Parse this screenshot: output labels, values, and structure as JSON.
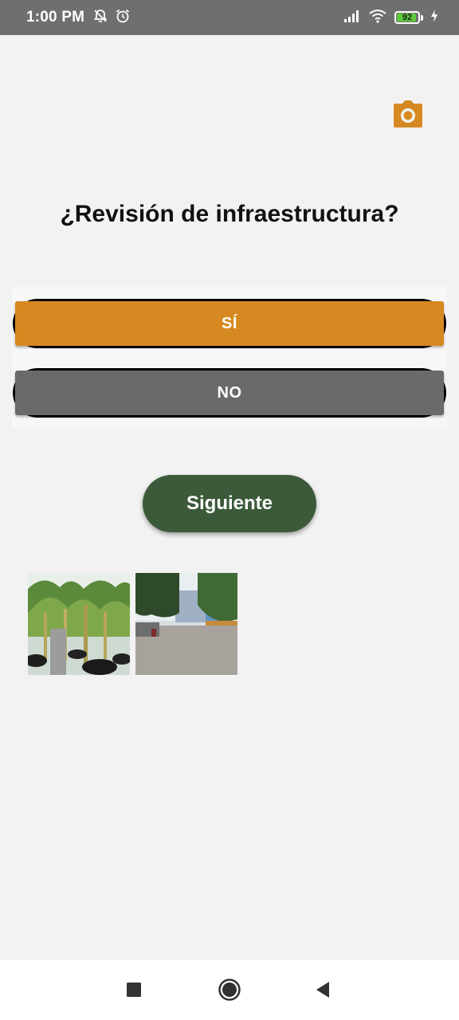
{
  "status_bar": {
    "time": "1:00 PM",
    "battery_level": "92",
    "battery_fraction": 0.92,
    "icons": [
      "notifications-off-icon",
      "alarm-icon",
      "signal-icon",
      "wifi-icon",
      "battery-icon",
      "charging-icon"
    ]
  },
  "toolbar": {
    "camera_icon": "camera-icon"
  },
  "question": {
    "title": "¿Revisión de infraestructura?"
  },
  "options": {
    "yes_label": "SÍ",
    "no_label": "NO"
  },
  "actions": {
    "next_label": "Siguiente"
  },
  "photos": [
    {
      "description": "banana-plants-greenhouse"
    },
    {
      "description": "street-courtyard-trees"
    }
  ],
  "nav_bar": {
    "icons": [
      "recent-apps-icon",
      "home-icon",
      "back-icon"
    ]
  },
  "colors": {
    "accent": "#d68920",
    "secondary": "#6a6a6a",
    "primary_dark": "#3c5a3a",
    "status_bar": "#6f6f6f",
    "background": "#f2f2f2"
  }
}
